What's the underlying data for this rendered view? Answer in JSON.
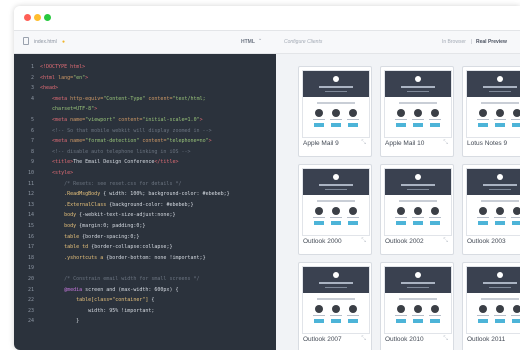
{
  "window": {
    "dot_colors": [
      "#ff5f56",
      "#ffbd2e",
      "#27c93f"
    ]
  },
  "toolbar": {
    "file_name": "index.html",
    "file_modified_indicator": "●",
    "language": "HTML",
    "language_chevron": "⌄",
    "configure_label": "Configure Clients",
    "mode_browser": "In Browser",
    "mode_separator": "|",
    "mode_real": "Real Preview"
  },
  "editor": {
    "lines": [
      {
        "n": "1",
        "t": [
          [
            "c-tag",
            "<!DOCTYPE html>"
          ]
        ]
      },
      {
        "n": "2",
        "t": [
          [
            "c-tag",
            "<html "
          ],
          [
            "c-attr",
            "lang="
          ],
          [
            "c-str",
            "\"en\""
          ],
          [
            "c-tag",
            ">"
          ]
        ]
      },
      {
        "n": "3",
        "t": [
          [
            "c-tag",
            "<head>"
          ]
        ]
      },
      {
        "n": "4",
        "t": [
          [
            "c-txt",
            "    "
          ],
          [
            "c-tag",
            "<meta "
          ],
          [
            "c-attr",
            "http-equiv="
          ],
          [
            "c-str",
            "\"Content-Type\" "
          ],
          [
            "c-attr",
            "content="
          ],
          [
            "c-str",
            "\"text/html;"
          ]
        ]
      },
      {
        "n": "",
        "t": [
          [
            "c-str",
            "    charset=UTF-8\""
          ],
          [
            "c-tag",
            ">"
          ]
        ]
      },
      {
        "n": "5",
        "t": [
          [
            "c-txt",
            "    "
          ],
          [
            "c-tag",
            "<meta "
          ],
          [
            "c-attr",
            "name="
          ],
          [
            "c-str",
            "\"viewport\" "
          ],
          [
            "c-attr",
            "content="
          ],
          [
            "c-str",
            "\"initial-scale=1.0\""
          ],
          [
            "c-tag",
            ">"
          ]
        ]
      },
      {
        "n": "6",
        "t": [
          [
            "c-com",
            "    <!-- So that mobile webkit will display zoomed in -->"
          ]
        ]
      },
      {
        "n": "7",
        "t": [
          [
            "c-txt",
            "    "
          ],
          [
            "c-tag",
            "<meta "
          ],
          [
            "c-attr",
            "name="
          ],
          [
            "c-str",
            "\"format-detection\" "
          ],
          [
            "c-attr",
            "content="
          ],
          [
            "c-str",
            "\"telephone=no\""
          ],
          [
            "c-tag",
            ">"
          ]
        ]
      },
      {
        "n": "8",
        "t": [
          [
            "c-com",
            "    <!-- disable auto telephone linking in iOS -->"
          ]
        ]
      },
      {
        "n": "9",
        "t": [
          [
            "c-txt",
            "    "
          ],
          [
            "c-tag",
            "<title>"
          ],
          [
            "c-txt",
            "The Email Design Conference"
          ],
          [
            "c-tag",
            "</title>"
          ]
        ]
      },
      {
        "n": "10",
        "t": [
          [
            "c-txt",
            "    "
          ],
          [
            "c-tag",
            "<style>"
          ]
        ]
      },
      {
        "n": "11",
        "t": [
          [
            "c-com",
            "        /* Resets: see reset.css for details */"
          ]
        ]
      },
      {
        "n": "12",
        "t": [
          [
            "c-sel",
            "        .ReadMsgBody "
          ],
          [
            "c-txt",
            "{ width: 100%; background-color: #ebebeb;}"
          ]
        ]
      },
      {
        "n": "13",
        "t": [
          [
            "c-sel",
            "        .ExternalClass "
          ],
          [
            "c-txt",
            "{background-color: #ebebeb;}"
          ]
        ]
      },
      {
        "n": "14",
        "t": [
          [
            "c-sel",
            "        body "
          ],
          [
            "c-txt",
            "{-webkit-text-size-adjust:none;}"
          ]
        ]
      },
      {
        "n": "15",
        "t": [
          [
            "c-sel",
            "        body "
          ],
          [
            "c-txt",
            "{margin:0; padding:0;}"
          ]
        ]
      },
      {
        "n": "16",
        "t": [
          [
            "c-sel",
            "        table "
          ],
          [
            "c-txt",
            "{border-spacing:0;}"
          ]
        ]
      },
      {
        "n": "17",
        "t": [
          [
            "c-sel",
            "        table td "
          ],
          [
            "c-txt",
            "{border-collapse:collapse;}"
          ]
        ]
      },
      {
        "n": "18",
        "t": [
          [
            "c-sel",
            "        .yshortcuts a "
          ],
          [
            "c-txt",
            "{border-bottom: none !important;}"
          ]
        ]
      },
      {
        "n": "19",
        "t": []
      },
      {
        "n": "20",
        "t": [
          [
            "c-com",
            "        /* Constrain email width for small screens */"
          ]
        ]
      },
      {
        "n": "21",
        "t": [
          [
            "c-kw",
            "        @media "
          ],
          [
            "c-txt",
            "screen and (max-width: 600px) {"
          ]
        ]
      },
      {
        "n": "22",
        "t": [
          [
            "c-sel",
            "            table[class=\"container\"] "
          ],
          [
            "c-txt",
            "{"
          ]
        ]
      },
      {
        "n": "23",
        "t": [
          [
            "c-txt",
            "                width: 95% !important;"
          ]
        ]
      },
      {
        "n": "24",
        "t": [
          [
            "c-txt",
            "            }"
          ]
        ]
      }
    ]
  },
  "preview": {
    "clients": [
      {
        "label": "Apple Mail 9"
      },
      {
        "label": "Apple Mail 10"
      },
      {
        "label": "Lotus Notes 9"
      },
      {
        "label": "Outlook 2000"
      },
      {
        "label": "Outlook 2002"
      },
      {
        "label": "Outlook 2003"
      },
      {
        "label": "Outlook 2007"
      },
      {
        "label": "Outlook 2010"
      },
      {
        "label": "Outlook 2011"
      }
    ]
  }
}
